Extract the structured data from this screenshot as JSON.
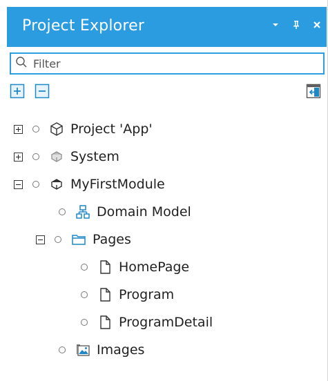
{
  "panel": {
    "title": "Project Explorer",
    "controls": {
      "dropdown": "chevron-down-icon",
      "pin": "pin-icon",
      "close": "close-icon"
    }
  },
  "filter": {
    "placeholder": "Filter",
    "value": ""
  },
  "toolbar": {
    "expand_all_icon": "expand-all-icon",
    "collapse_all_icon": "collapse-all-icon",
    "sync_icon": "sync-with-editor-icon"
  },
  "tree": [
    {
      "label": "Project 'App'",
      "icon": "project-icon",
      "expander": "plus"
    },
    {
      "label": "System",
      "icon": "module-icon",
      "expander": "plus"
    },
    {
      "label": "MyFirstModule",
      "icon": "module-icon",
      "expander": "minus"
    },
    {
      "label": "Domain Model",
      "icon": "domain-model-icon",
      "expander": ""
    },
    {
      "label": "Pages",
      "icon": "folder-icon",
      "expander": "minus"
    },
    {
      "label": "HomePage",
      "icon": "page-icon",
      "expander": ""
    },
    {
      "label": "Program",
      "icon": "page-icon",
      "expander": ""
    },
    {
      "label": "ProgramDetail",
      "icon": "page-icon",
      "expander": ""
    },
    {
      "label": "Images",
      "icon": "images-folder-icon",
      "expander": ""
    }
  ],
  "colors": {
    "accent": "#2b9ce0",
    "title_text": "#ffffff"
  }
}
